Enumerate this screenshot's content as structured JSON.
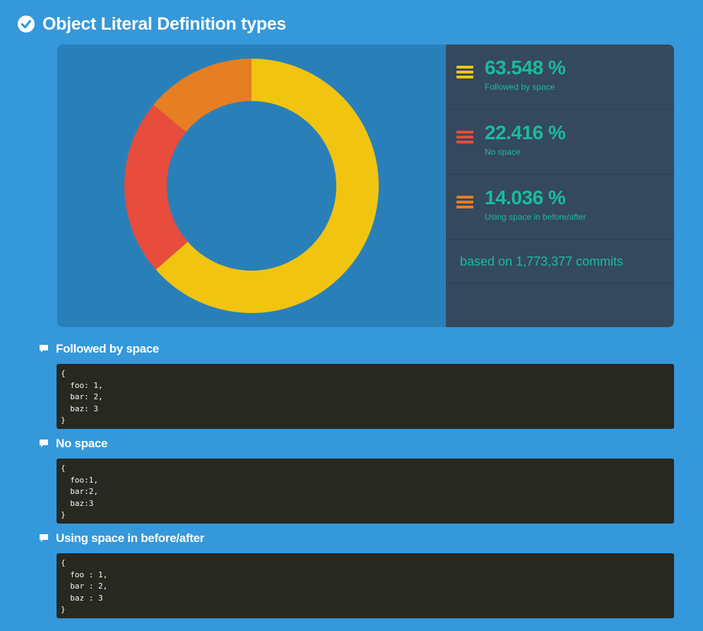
{
  "title": "Object Literal Definition types",
  "chart_data": {
    "type": "pie",
    "donut": true,
    "slices": [
      {
        "label": "Followed by space",
        "value": 63.548,
        "display": "63.548 %",
        "color": "#f1c40f"
      },
      {
        "label": "No space",
        "value": 22.416,
        "display": "22.416 %",
        "color": "#e74c3c"
      },
      {
        "label": "Using space in before/after",
        "value": 14.036,
        "display": "14.036 %",
        "color": "#e67e22"
      }
    ],
    "commits_note": "based on 1,773,377 commits"
  },
  "examples": [
    {
      "title": "Followed by space",
      "code": "{\n  foo: 1,\n  bar: 2,\n  baz: 3\n}"
    },
    {
      "title": "No space",
      "code": "{\n  foo:1,\n  bar:2,\n  baz:3\n}"
    },
    {
      "title": "Using space in before/after",
      "code": "{\n  foo : 1,\n  bar : 2,\n  baz : 3\n}"
    }
  ],
  "colors": {
    "background": "#3498db",
    "chart_bg": "#2980b9",
    "panel_bg": "#34495e",
    "accent_text": "#1abc9c",
    "code_bg": "#272822"
  }
}
